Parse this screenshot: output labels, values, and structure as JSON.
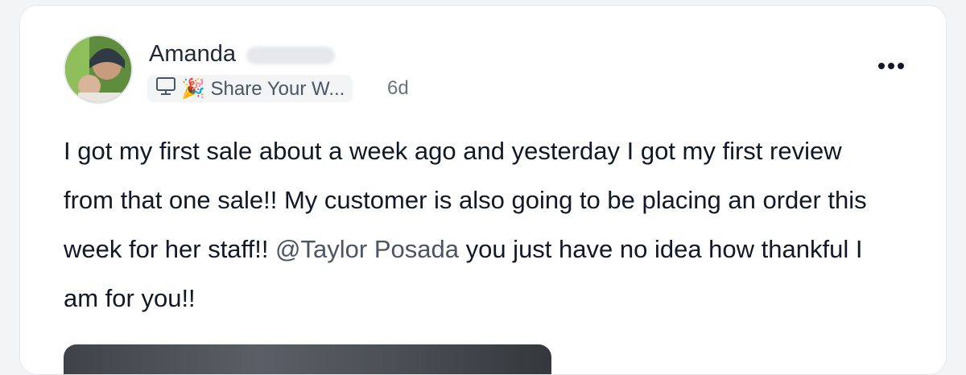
{
  "post": {
    "author_name": "Amanda",
    "space_name": "🎉 Share Your W...",
    "time_ago": "6d",
    "body_text_1": "I got my first sale about a week ago and yesterday I got my first review from that one sale!! My customer is also going to be placing an order this week for her staff!! ",
    "mention": "@Taylor Posada",
    "body_text_2": " you just have no idea how thankful I am for you!!",
    "more_icon": "more-horizontal-icon",
    "space_icon": "monitor-icon"
  }
}
